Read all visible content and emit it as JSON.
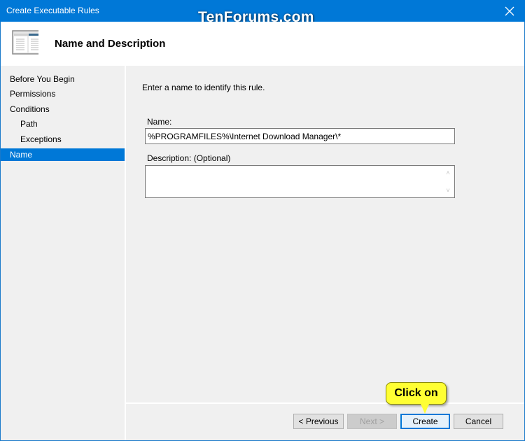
{
  "window": {
    "title": "Create Executable Rules",
    "watermark": "TenForums.com",
    "close_icon": "close-icon"
  },
  "header": {
    "icon": "wizard-window-icon",
    "title": "Name and Description"
  },
  "sidebar": {
    "items": [
      {
        "label": "Before You Begin",
        "active": false,
        "sub": false
      },
      {
        "label": "Permissions",
        "active": false,
        "sub": false
      },
      {
        "label": "Conditions",
        "active": false,
        "sub": false
      },
      {
        "label": "Path",
        "active": false,
        "sub": true
      },
      {
        "label": "Exceptions",
        "active": false,
        "sub": true
      },
      {
        "label": "Name",
        "active": true,
        "sub": false
      }
    ]
  },
  "main": {
    "instruction": "Enter a name to identify this rule.",
    "name_label": "Name:",
    "name_value": "%PROGRAMFILES%\\Internet Download Manager\\*",
    "description_label": "Description: (Optional)",
    "description_value": ""
  },
  "buttons": {
    "previous": "< Previous",
    "next": "Next >",
    "create": "Create",
    "cancel": "Cancel"
  },
  "annotation": {
    "callout_text": "Click on"
  },
  "colors": {
    "accent": "#0078d7",
    "callout": "#ffff33"
  }
}
